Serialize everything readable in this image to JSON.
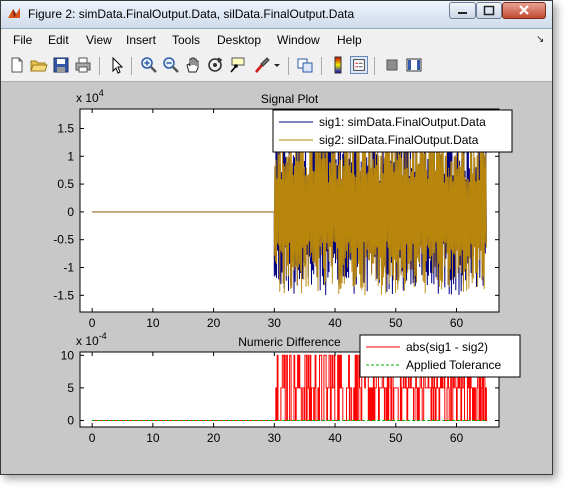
{
  "window": {
    "title": "Figure 2: simData.FinalOutput.Data, silData.FinalOutput.Data"
  },
  "menu": [
    "File",
    "Edit",
    "View",
    "Insert",
    "Tools",
    "Desktop",
    "Window",
    "Help"
  ],
  "toolbar": {
    "icons": [
      "new-figure-icon",
      "open-file-icon",
      "save-icon",
      "print-icon",
      "edit-plot-arrow-icon",
      "zoom-in-icon",
      "zoom-out-icon",
      "pan-hand-icon",
      "rotate-3d-icon",
      "data-cursor-icon",
      "brush-icon",
      "link-plot-icon",
      "insert-colorbar-icon",
      "insert-legend-icon",
      "hide-plot-tools-icon",
      "show-plot-tools-icon"
    ]
  },
  "colors": {
    "sig1": "#000080",
    "sig2": "#b8860b",
    "diff": "#ff0000",
    "tolerance": "#00b000",
    "figure_bg": "#c8c8c8",
    "axes_bg": "#ffffff"
  },
  "chart_data": [
    {
      "type": "line",
      "title": "Signal Plot",
      "xlabel": "",
      "ylabel": "",
      "y_exponent_label": "x 10",
      "y_exponent_power": "4",
      "xlim": [
        -2,
        67
      ],
      "ylim": [
        -1.8,
        1.85
      ],
      "xticks": [
        "0",
        "10",
        "20",
        "30",
        "40",
        "50",
        "60"
      ],
      "yticks": [
        "-1.5",
        "-1",
        "-0.5",
        "0",
        "0.5",
        "1",
        "1.5"
      ],
      "legend": {
        "position": "top-right",
        "entries": [
          "sig1: simData.FinalOutput.Data",
          "sig2: silData.FinalOutput.Data"
        ]
      },
      "series": [
        {
          "name": "sig1: simData.FinalOutput.Data",
          "description": "overlaid with sig2",
          "x_start": 0,
          "x_end": 65,
          "constant_until": 30,
          "value_before": 0,
          "oscillation_range": [
            -1.5,
            1.5
          ]
        },
        {
          "name": "sig2: silData.FinalOutput.Data",
          "x_start": 0,
          "x_end": 65,
          "constant_until": 30,
          "value_before": 0,
          "oscillation_range": [
            -1.5,
            1.5
          ]
        }
      ]
    },
    {
      "type": "line",
      "title": "Numeric Difference",
      "xlabel": "",
      "ylabel": "",
      "y_exponent_label": "x 10",
      "y_exponent_power": "-4",
      "xlim": [
        -2,
        67
      ],
      "ylim": [
        -1,
        10.5
      ],
      "xticks": [
        "0",
        "10",
        "20",
        "30",
        "40",
        "50",
        "60"
      ],
      "yticks": [
        "0",
        "5",
        "10"
      ],
      "legend": {
        "position": "top-right",
        "entries": [
          "abs(sig1 - sig2)",
          "Applied Tolerance"
        ]
      },
      "series": [
        {
          "name": "abs(sig1 - sig2)",
          "x_start": 0,
          "x_end": 65,
          "zero_until": 30,
          "values_after": [
            0,
            5,
            10
          ]
        },
        {
          "name": "Applied Tolerance",
          "x": [
            0,
            65
          ],
          "y": [
            0,
            0
          ]
        }
      ]
    }
  ]
}
